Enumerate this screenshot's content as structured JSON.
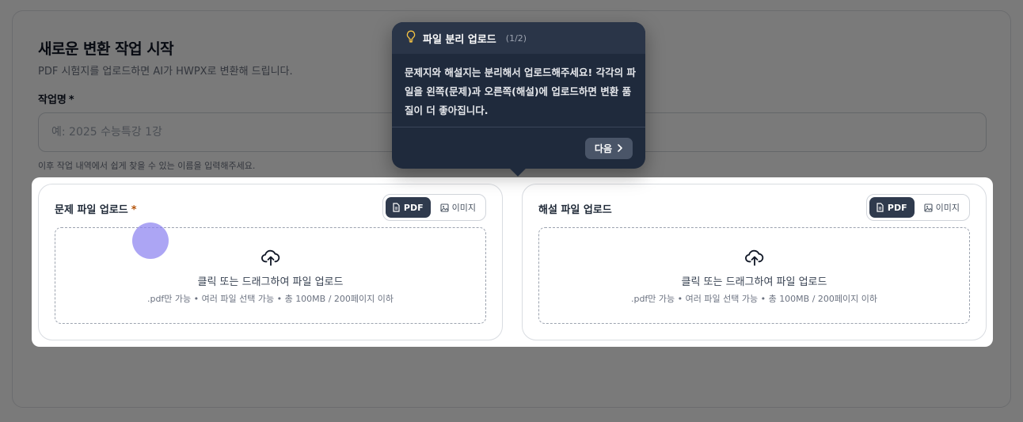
{
  "form": {
    "title": "새로운 변환 작업 시작",
    "subtitle": "PDF 시험지를 업로드하면 AI가 HWPX로 변환해 드립니다.",
    "job_label": "작업명",
    "required_mark": "*",
    "job_placeholder": "예: 2025 수능특강 1강",
    "job_value": "",
    "job_hint": "이후 작업 내역에서 쉽게 찾을 수 있는 이름을 입력해주세요."
  },
  "uploads": [
    {
      "title": "문제 파일 업로드",
      "required_mark": "*",
      "modes": [
        "PDF",
        "이미지"
      ],
      "active_mode": "PDF",
      "drop_main": "클릭 또는 드래그하여 파일 업로드",
      "drop_sub": ".pdf만 가능 • 여러 파일 선택 가능 • 총 100MB / 200페이지 이하"
    },
    {
      "title": "해설 파일 업로드",
      "modes": [
        "PDF",
        "이미지"
      ],
      "active_mode": "PDF",
      "drop_main": "클릭 또는 드래그하여 파일 업로드",
      "drop_sub": ".pdf만 가능 • 여러 파일 선택 가능 • 총 100MB / 200페이지 이하"
    }
  ],
  "tour": {
    "icon": "lightbulb-icon",
    "title": "파일 분리 업로드",
    "step": "(1/2)",
    "body": "문제지와 해설지는 분리해서 업로드해주세요! 각각의 파일을 왼쪽(문제)과 오른쪽(해설)에 업로드하면 변환 품질이 더 좋아집니다.",
    "next_label": "다음"
  },
  "colors": {
    "overlay": "#000000",
    "tooltip_bg": "#1f2a3c",
    "toggle_active": "#2f3a4d",
    "required_star": "#b45309",
    "bulb": "#f6c343",
    "cursor": "#8c82f0"
  }
}
